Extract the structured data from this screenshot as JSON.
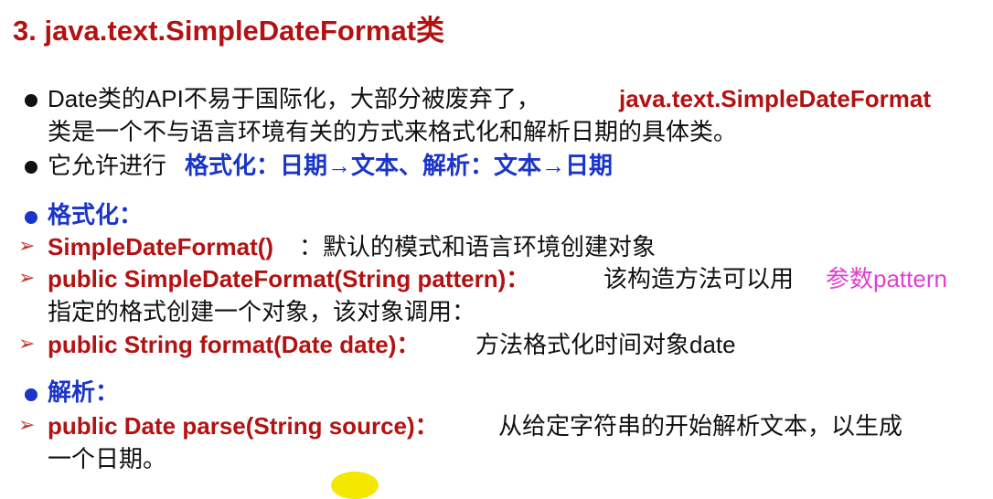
{
  "title": "3. java.text.SimpleDateFormat类",
  "bullets": {
    "b1": {
      "part1": "Date类的API不易于国际化，大部分被废弃了，",
      "part2": "java.text.SimpleDateFormat",
      "line2": "类是一个不与语言环境有关的方式来格式化和解析日期的具体类。"
    },
    "b2": {
      "part1": "它允许进行",
      "part2": "格式化：日期→文本、解析：文本→日期"
    }
  },
  "format_section": {
    "heading": "格式化：",
    "items": [
      {
        "code": "SimpleDateFormat()",
        "desc": " ：默认的模式和语言环境创建对象"
      },
      {
        "code": "public SimpleDateFormat(String pattern)：",
        "desc": "该构造方法可以用",
        "highlight": "参数pattern",
        "line2": "指定的格式创建一个对象，该对象调用："
      },
      {
        "code": "public String format(Date date)：",
        "desc": "方法格式化时间对象date"
      }
    ]
  },
  "parse_section": {
    "heading": "解析：",
    "items": [
      {
        "code": "public Date parse(String source)：",
        "desc": "从给定字符串的开始解析文本，以生成",
        "line2": "一个日期。"
      }
    ]
  },
  "colors": {
    "title_red": "#b31212",
    "code_red": "#b31212",
    "heading_blue": "#1a35c8",
    "highlight_magenta": "#e040d0",
    "bullet_black": "#111111",
    "blob_yellow": "#f4e800"
  }
}
